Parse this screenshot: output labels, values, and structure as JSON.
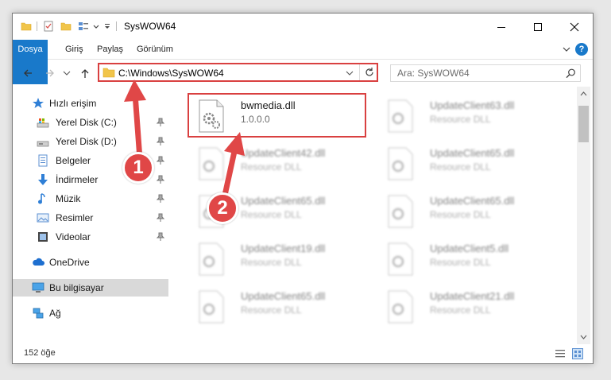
{
  "window": {
    "title": "SysWOW64"
  },
  "ribbon": {
    "tabs": [
      "Dosya",
      "Giriş",
      "Paylaş",
      "Görünüm"
    ],
    "help": "?"
  },
  "address": {
    "path": "C:\\Windows\\SysWOW64"
  },
  "search": {
    "placeholder": "Ara: SysWOW64"
  },
  "nav": {
    "quick_access": "Hızlı erişim",
    "items": [
      "Yerel Disk (C:)",
      "Yerel Disk (D:)",
      "Belgeler",
      "İndirmeler",
      "Müzik",
      "Resimler",
      "Videolar"
    ],
    "onedrive": "OneDrive",
    "this_pc": "Bu bilgisayar",
    "network": "Ağ"
  },
  "files": {
    "main": {
      "name": "bwmedia.dll",
      "type": "1.0.0.0"
    },
    "left": [
      {
        "name": "UpdateClient42.dll",
        "type": "Resource DLL"
      },
      {
        "name": "UpdateClient65.dll",
        "type": "Resource DLL"
      },
      {
        "name": "UpdateClient19.dll",
        "type": "Resource DLL"
      },
      {
        "name": "UpdateClient65.dll",
        "type": "Resource DLL"
      }
    ],
    "right": [
      {
        "name": "UpdateClient63.dll",
        "type": "Resource DLL"
      },
      {
        "name": "UpdateClient65.dll",
        "type": "Resource DLL"
      },
      {
        "name": "UpdateClient65.dll",
        "type": "Resource DLL"
      },
      {
        "name": "UpdateClient5.dll",
        "type": "Resource DLL"
      },
      {
        "name": "UpdateClient21.dll",
        "type": "Resource DLL"
      }
    ]
  },
  "status": {
    "count": "152 öğe"
  },
  "callouts": [
    "1",
    "2"
  ],
  "colors": {
    "accent": "#1979ca",
    "highlight": "#d94040",
    "callout": "#e04747"
  }
}
